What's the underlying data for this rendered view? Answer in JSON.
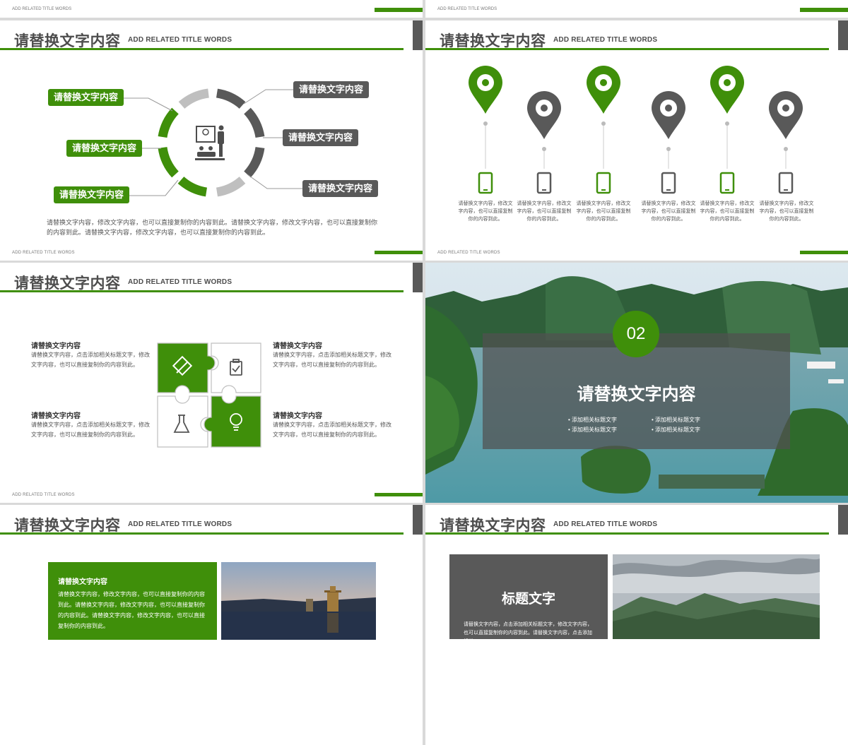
{
  "common": {
    "title": "请替换文字内容",
    "subtitle": "ADD RELATED TITLE WORDS",
    "footer": "ADD RELATED TITLE WORDS"
  },
  "slide1": {
    "left_labels": [
      "请替换文字内容",
      "请替换文字内容",
      "请替换文字内容"
    ],
    "right_labels": [
      "请替换文字内容",
      "请替换文字内容",
      "请替换文字内容"
    ],
    "body_text": "请替换文字内容，修改文字内容，也可以直接复制你的内容到此。请替换文字内容，修改文字内容，也可以直接复制你的内容到此。请替换文字内容，修改文字内容，也可以直接复制你的内容到此。",
    "center_icon": "presentation-icon"
  },
  "slide2": {
    "captions": [
      "请替换文字内容，修改文字内容，也可以直接复制你的内容到此。",
      "请替换文字内容，修改文字内容，也可以直接复制你的内容到此。",
      "请替换文字内容，修改文字内容，也可以直接复制你的内容到此。",
      "请替换文字内容，修改文字内容，也可以直接复制你的内容到此。",
      "请替换文字内容，修改文字内容，也可以直接复制你的内容到此。",
      "请替换文字内容，修改文字内容，也可以直接复制你的内容到此。"
    ],
    "pin_colors": [
      "#3f8f0a",
      "#595959",
      "#3f8f0a",
      "#595959",
      "#3f8f0a",
      "#595959"
    ]
  },
  "slide3": {
    "items": [
      {
        "title": "请替换文字内容",
        "text": "请替换文字内容，点击添加相关标题文字，修改文字内容，也可以直接复制你的内容到此。"
      },
      {
        "title": "请替换文字内容",
        "text": "请替换文字内容，点击添加相关标题文字，修改文字内容，也可以直接复制你的内容到此。"
      },
      {
        "title": "请替换文字内容",
        "text": "请替换文字内容，点击添加相关标题文字，修改文字内容，也可以直接复制你的内容到此。"
      },
      {
        "title": "请替换文字内容",
        "text": "请替换文字内容，点击添加相关标题文字，修改文字内容，也可以直接复制你的内容到此。"
      }
    ],
    "icons": [
      "pencil-ruler-icon",
      "clipboard-check-icon",
      "flask-icon",
      "lightbulb-icon"
    ]
  },
  "slide4": {
    "number": "02",
    "heading": "请替换文字内容",
    "bullets": [
      "添加相关标题文字",
      "添加相关标题文字",
      "添加相关标题文字",
      "添加相关标题文字"
    ]
  },
  "slide5": {
    "card_title": "请替换文字内容",
    "card_text": "请替换文字内容，修改文字内容，也可以直接复制你的内容到此。请替换文字内容，修改文字内容，也可以直接复制你的内容到此。请替换文字内容，修改文字内容，也可以直接复制你的内容到此。"
  },
  "slide6": {
    "card_title": "标题文字",
    "card_text": "请替换文字内容，点击添加相关标题文字，修改文字内容，也可以直接复制你的内容到此。请替换文字内容，点击添加相关"
  },
  "colors": {
    "green": "#3f8f0a",
    "dark": "#595959"
  }
}
